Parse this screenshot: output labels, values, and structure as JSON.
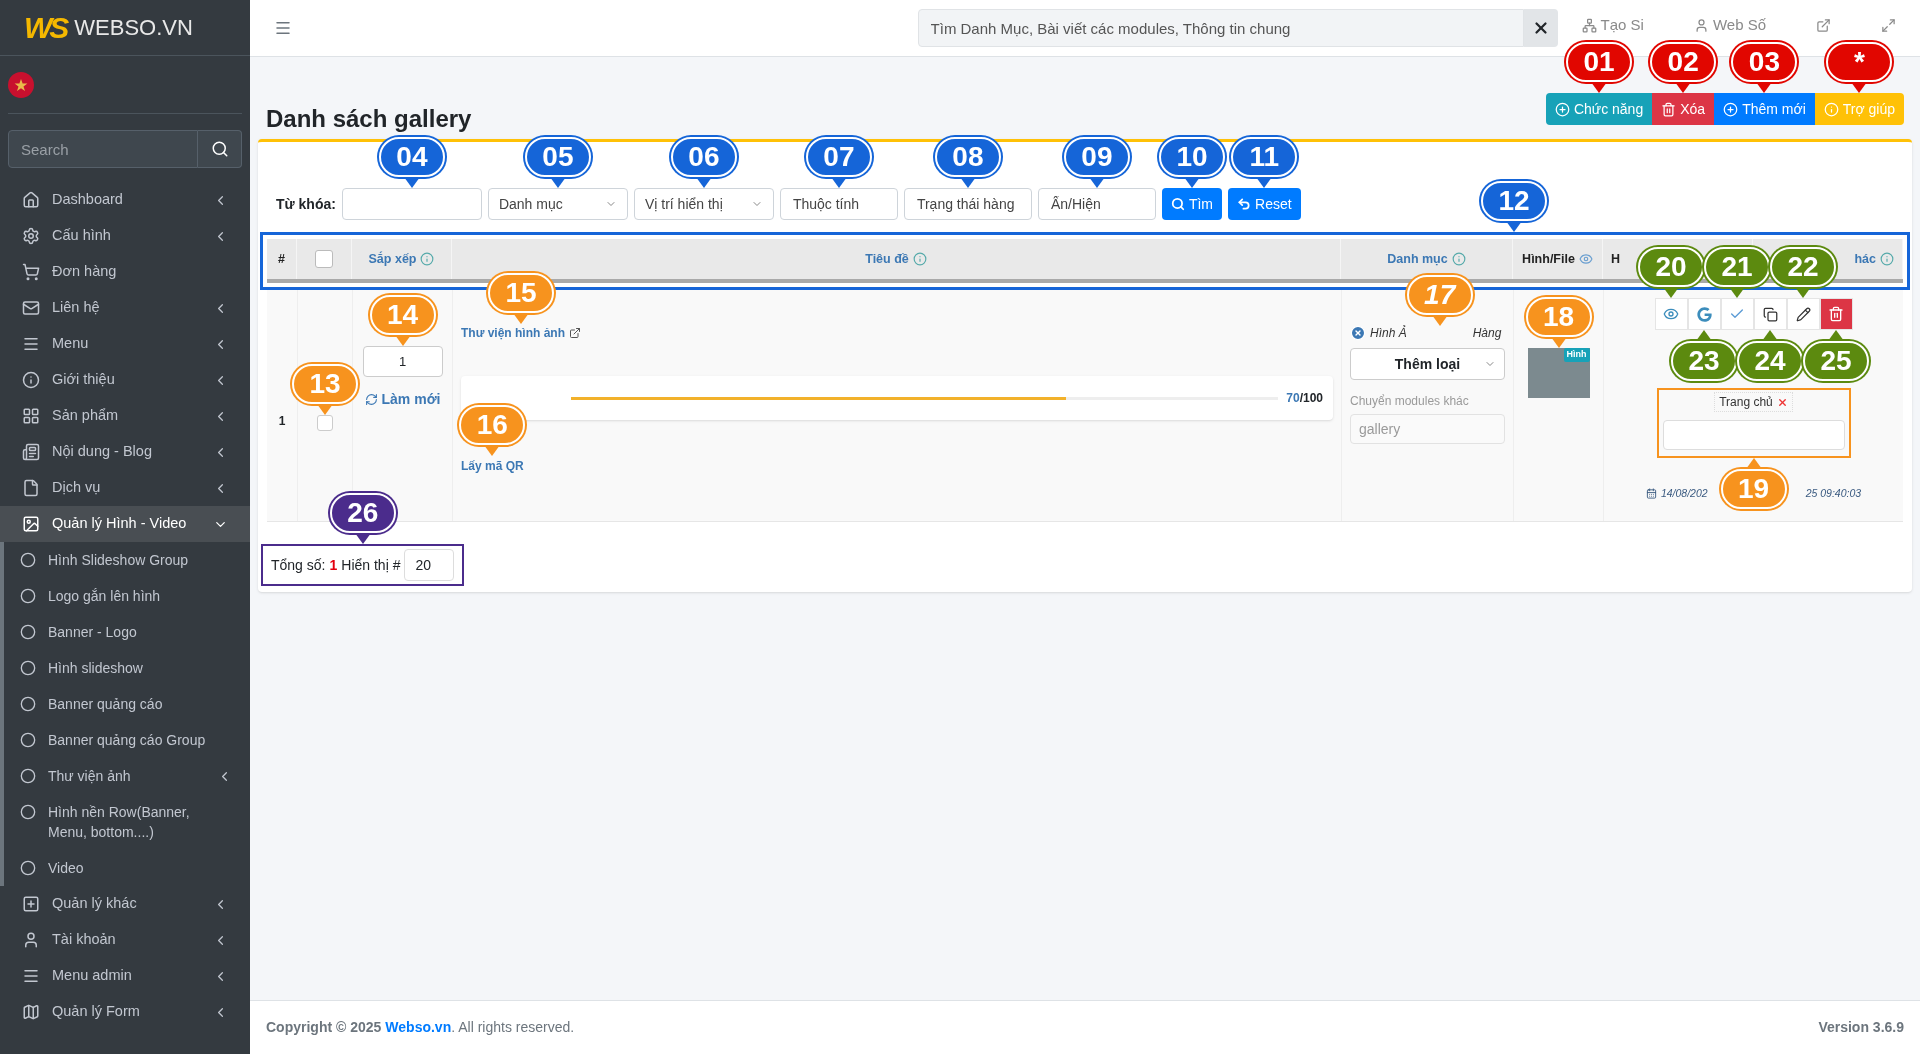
{
  "sidebar": {
    "logo_mark": "WS",
    "brand": "WEBSO.VN",
    "search": {
      "placeholder": "Search"
    },
    "items": [
      {
        "label": "Dashboard",
        "kind": "group",
        "expanded": false,
        "selected": false
      },
      {
        "label": "Cấu hình",
        "kind": "group",
        "expanded": false,
        "selected": false
      },
      {
        "label": "Đơn hàng",
        "kind": "link",
        "selected": false
      },
      {
        "label": "Liên hệ",
        "kind": "group",
        "expanded": false,
        "selected": false
      },
      {
        "label": "Menu",
        "kind": "group",
        "expanded": false,
        "selected": false
      },
      {
        "label": "Giới thiệu",
        "kind": "group",
        "expanded": false,
        "selected": false
      },
      {
        "label": "Sản phẩm",
        "kind": "group",
        "expanded": false,
        "selected": false
      },
      {
        "label": "Nội dung - Blog",
        "kind": "group",
        "expanded": false,
        "selected": false
      },
      {
        "label": "Dịch vụ",
        "kind": "group",
        "expanded": false,
        "selected": false
      },
      {
        "label": "Quản lý Hình - Video",
        "kind": "group",
        "expanded": true,
        "selected": true,
        "children": [
          {
            "label": "Hình Slideshow Group",
            "kind": "link"
          },
          {
            "label": "Logo gắn lên hình",
            "kind": "link"
          },
          {
            "label": "Banner - Logo",
            "kind": "link"
          },
          {
            "label": "Hình slideshow",
            "kind": "link"
          },
          {
            "label": "Banner quảng cáo",
            "kind": "link"
          },
          {
            "label": "Banner quảng cáo Group",
            "kind": "link"
          },
          {
            "label": "Thư viện ảnh",
            "kind": "group"
          },
          {
            "label": "Hình nền Row(Banner, Menu, bottom....)",
            "kind": "link"
          },
          {
            "label": "Video",
            "kind": "link"
          }
        ]
      },
      {
        "label": "Quản lý khác",
        "kind": "group",
        "expanded": false,
        "selected": false
      },
      {
        "label": "Tài khoản",
        "kind": "group",
        "expanded": false,
        "selected": false
      },
      {
        "label": "Menu admin",
        "kind": "group",
        "expanded": false,
        "selected": false
      },
      {
        "label": "Quản lý Form",
        "kind": "group",
        "expanded": false,
        "selected": false
      }
    ]
  },
  "topbar": {
    "search": {
      "placeholder": "Tìm Danh Mục, Bài viết các modules, Thông tin chung"
    },
    "links": [
      "Tạo Si",
      "Web Số"
    ]
  },
  "page": {
    "title": "Danh sách gallery",
    "actions": [
      {
        "label": "Chức năng",
        "kind": "function",
        "callout": {
          "label": "01",
          "color": "#e10600"
        }
      },
      {
        "label": "Xóa",
        "kind": "delete",
        "callout": {
          "label": "02",
          "color": "#e10600"
        }
      },
      {
        "label": "Thêm mới",
        "kind": "add",
        "callout": {
          "label": "03",
          "color": "#e10600"
        }
      },
      {
        "label": "Trợ giúp",
        "kind": "help",
        "callout": {
          "label": "*",
          "color": "#e10600"
        }
      }
    ]
  },
  "filters": {
    "keyword_label": "Từ khóa:",
    "keyword_callout": {
      "label": "04",
      "color": "#1565d8"
    },
    "fields": [
      {
        "kind": "select",
        "value": "Danh mục",
        "callout": {
          "label": "05",
          "color": "#1565d8"
        }
      },
      {
        "kind": "select",
        "value": "Vị trí hiển thị",
        "callout": {
          "label": "06",
          "color": "#1565d8"
        }
      },
      {
        "kind": "input",
        "placeholder": "Thuộc tính",
        "callout": {
          "label": "07",
          "color": "#1565d8"
        }
      },
      {
        "kind": "input",
        "placeholder": "Trạng thái hàng",
        "callout": {
          "label": "08",
          "color": "#1565d8"
        }
      },
      {
        "kind": "input",
        "placeholder": "Ẩn/Hiện",
        "callout": {
          "label": "09",
          "color": "#1565d8"
        }
      }
    ],
    "buttons": [
      {
        "label": "Tìm",
        "kind": "search",
        "callout": {
          "label": "10",
          "color": "#1565d8"
        }
      },
      {
        "label": "Reset",
        "kind": "reset",
        "callout": {
          "label": "11",
          "color": "#1565d8"
        }
      }
    ]
  },
  "table": {
    "callout": {
      "label": "12",
      "color": "#1565d8"
    },
    "columns": [
      {
        "kind": "text",
        "label": "#"
      },
      {
        "kind": "checkbox",
        "checked": false
      },
      {
        "kind": "info",
        "label": "Sắp xếp"
      },
      {
        "kind": "info",
        "label": "Tiêu đề"
      },
      {
        "kind": "info",
        "label": "Danh mục"
      },
      {
        "kind": "view",
        "label": "Hình/File"
      },
      {
        "kind": "text",
        "label": "H"
      },
      {
        "kind": "info",
        "label": "hác"
      }
    ],
    "rows": [
      {
        "number": "1",
        "checked": false,
        "check_callout": {
          "label": "13",
          "color": "#f7931e"
        },
        "order": "1",
        "order_callout": {
          "label": "14",
          "color": "#f7931e"
        },
        "refresh_label": "Làm mới",
        "title": "Thư viện hình ảnh",
        "title_callout": {
          "label": "15",
          "color": "#f7931e"
        },
        "score": "70",
        "score_max": "/100",
        "level": 0.7,
        "qr_label": "Lấy mã QR",
        "qr_callout": {
          "label": "16",
          "color": "#f7931e"
        },
        "category_parts": [
          "Hình Ả",
          "Hàng"
        ],
        "category_callout": {
          "label": "17",
          "color": "#f7931e"
        },
        "category_select": "Thêm loại",
        "move_label": "Chuyển modules khác",
        "move_value": "gallery",
        "image_badge": "Hình",
        "image_callout": {
          "label": "18",
          "color": "#f7931e"
        },
        "actions": [
          {
            "kind": "view",
            "callout": {
              "label": "20",
              "color": "#5c8a0f"
            }
          },
          {
            "kind": "google",
            "callout": {
              "label": "23",
              "color": "#5c8a0f"
            }
          },
          {
            "kind": "check",
            "callout": {
              "label": "21",
              "color": "#5c8a0f"
            }
          },
          {
            "kind": "copy",
            "callout": {
              "label": "24",
              "color": "#5c8a0f"
            }
          },
          {
            "kind": "edit",
            "callout": {
              "label": "22",
              "color": "#5c8a0f"
            }
          },
          {
            "kind": "delete",
            "callout": {
              "label": "25",
              "color": "#5c8a0f"
            }
          }
        ],
        "tags": [
          "Trang chủ"
        ],
        "tag_callout": {
          "label": "19",
          "color": "#f7931e"
        },
        "date_parts": [
          "14/08/202",
          "25 09:40:03"
        ]
      }
    ]
  },
  "summary": {
    "total_label": "Tổng số:",
    "total": "1",
    "display_label": "Hiển thị #",
    "per_page": "20",
    "callout": {
      "label": "26",
      "color": "#4b2c8c"
    }
  },
  "footer": {
    "copyright": "Copyright © 2025",
    "site_link": "Webso.vn",
    "rights": ". All rights reserved.",
    "version": "Version 3.6.9"
  }
}
